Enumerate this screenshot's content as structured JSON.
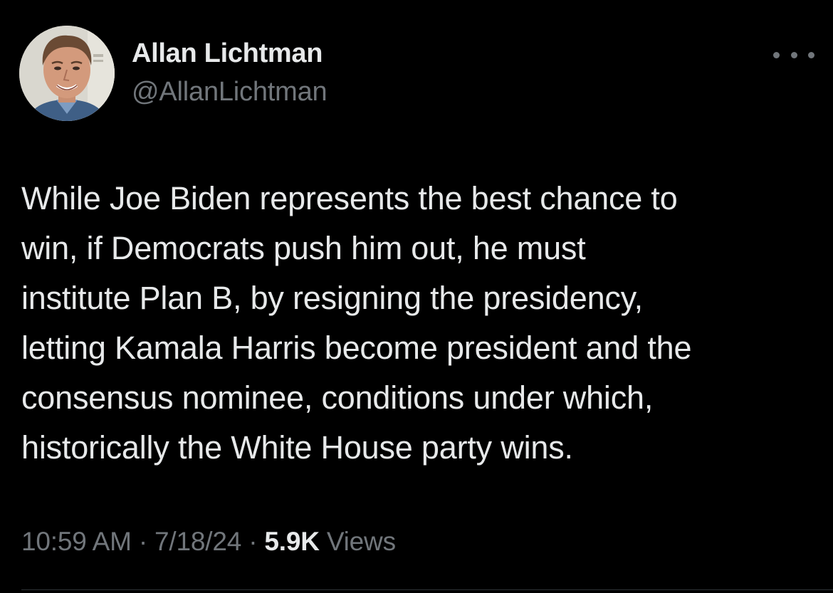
{
  "author": {
    "display_name": "Allan Lichtman",
    "handle": "@AllanLichtman"
  },
  "more_icon": "more-horizontal-icon",
  "tweet": {
    "lines": [
      "While Joe Biden represents the best chance to",
      "win, if Democrats push him out, he must",
      "institute Plan B, by resigning the presidency,",
      "letting Kamala Harris become president and the",
      "consensus nominee, conditions under which,",
      "historically the White House party wins."
    ]
  },
  "meta": {
    "time": "10:59 AM",
    "separator": "·",
    "date": "7/18/24",
    "views_count": "5.9K",
    "views_label": "Views"
  },
  "colors": {
    "background": "#000000",
    "primary_text": "#e7e9ea",
    "secondary_text": "#71767b",
    "divider": "#2f3336"
  }
}
